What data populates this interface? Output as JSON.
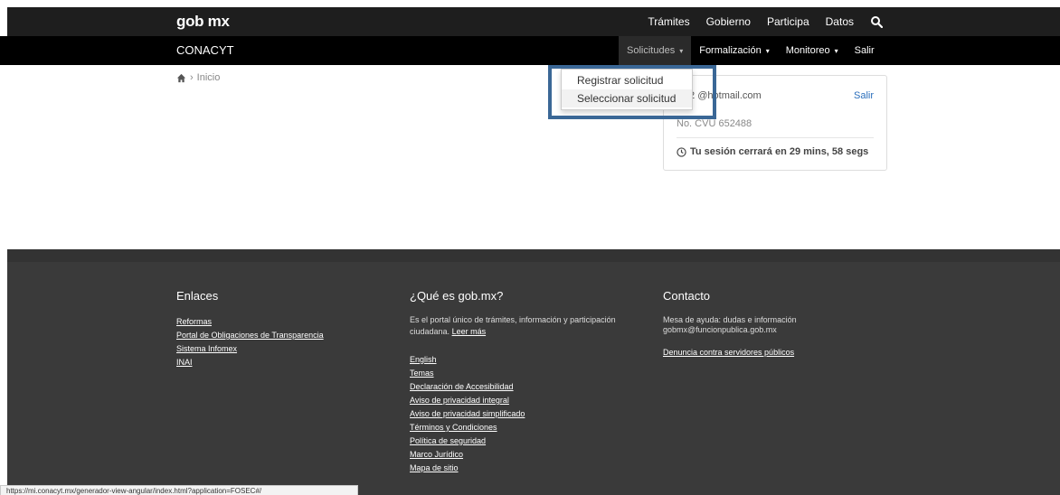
{
  "header": {
    "logo": "gob mx",
    "nav": [
      "Trámites",
      "Gobierno",
      "Participa",
      "Datos"
    ]
  },
  "subheader": {
    "brand": "CONACYT",
    "menu": [
      {
        "label": "Solicitudes",
        "caret": "▾"
      },
      {
        "label": "Formalización",
        "caret": "▾"
      },
      {
        "label": "Monitoreo",
        "caret": "▾"
      },
      {
        "label": "Salir",
        "caret": ""
      }
    ]
  },
  "breadcrumb": {
    "label": "Inicio",
    "separator": "›"
  },
  "dropdown": {
    "options": [
      "Registrar solicitud",
      "Seleccionar solicitud"
    ]
  },
  "user_card": {
    "email": "is_2 @hotmail.com",
    "logout": "Salir",
    "registration": "No. CVU 652488",
    "session": "Tu sesión cerrará en 29 mins, 58 segs"
  },
  "footer": {
    "enlaces": {
      "title": "Enlaces",
      "links": [
        "Reformas",
        "Portal de Obligaciones de Transparencia",
        "Sistema Infomex",
        "INAI"
      ]
    },
    "que_es": {
      "title": "¿Qué es gob.mx?",
      "description": "Es el portal único de trámites, información y participación ciudadana.",
      "read_more": "Leer más",
      "links": [
        "English",
        "Temas",
        "Declaración de Accesibilidad",
        "Aviso de privacidad integral",
        "Aviso de privacidad simplificado",
        "Términos y Condiciones",
        "Política de seguridad",
        "Marco Jurídico",
        "Mapa de sitio"
      ]
    },
    "contacto": {
      "title": "Contacto",
      "line1": "Mesa de ayuda: dudas e información",
      "line2": "gobmx@funcionpublica.gob.mx",
      "link": "Denuncia contra servidores públicos"
    }
  },
  "status_bar": "https://mi.conacyt.mx/generador-view-angular/index.html?application=FOSEC#/",
  "colors": {
    "topbar": "#1e1e1e",
    "subbar": "#000000",
    "footer": "#3a3a3a",
    "highlight": "#3a6796",
    "link": "#2a6ebb"
  }
}
